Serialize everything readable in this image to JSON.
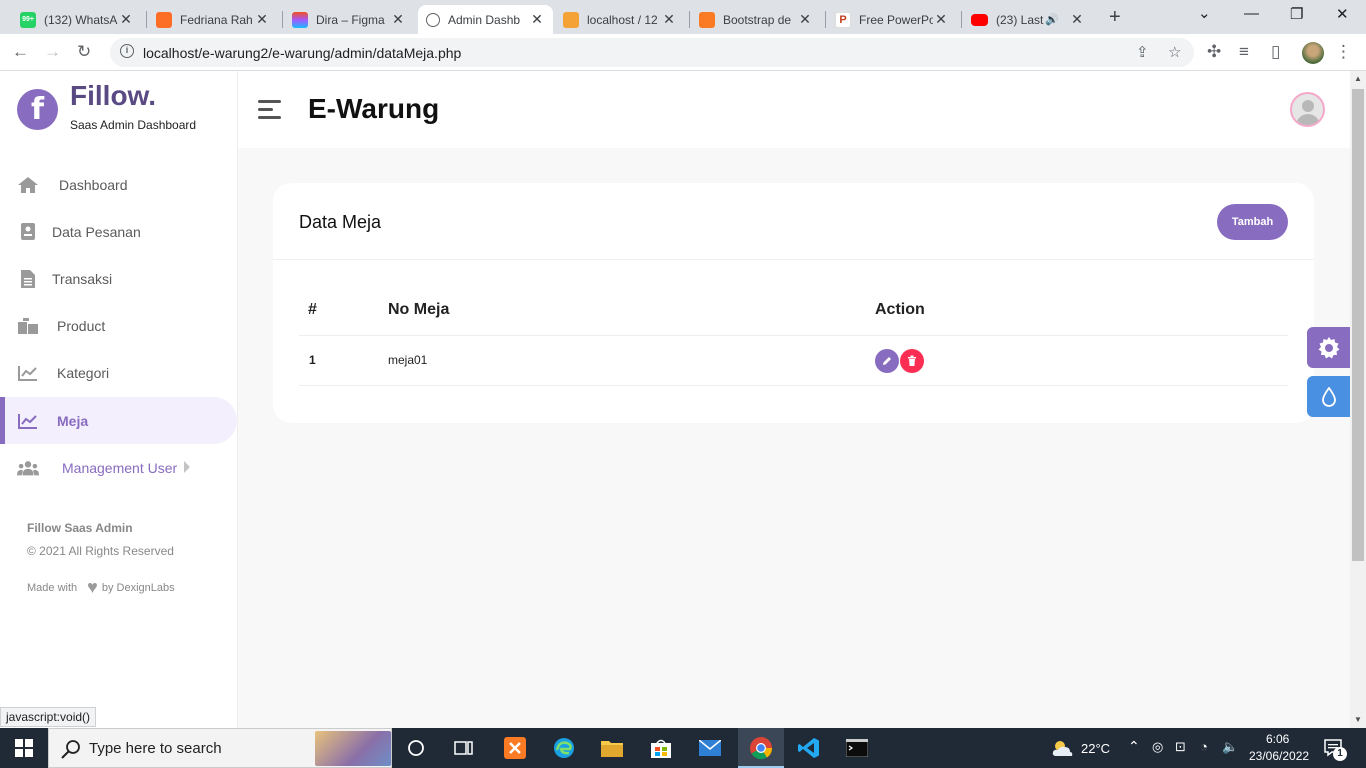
{
  "browser": {
    "tabs": [
      {
        "title": "(132) WhatsA",
        "badge": "99+"
      },
      {
        "title": "Fedriana Rah"
      },
      {
        "title": "Dira – Figma"
      },
      {
        "title": "Admin Dashb"
      },
      {
        "title": "localhost / 12"
      },
      {
        "title": "Bootstrap de"
      },
      {
        "title": "Free PowerPo"
      },
      {
        "title": "(23) Last"
      }
    ],
    "url": "localhost/e-warung2/e-warung/admin/dataMeja.php",
    "status_url": "javascript:void()"
  },
  "sidebar": {
    "brand_logo_letter": "f",
    "brand_name": "Fillow.",
    "brand_subtitle": "Saas Admin Dashboard",
    "items": [
      {
        "label": "Dashboard",
        "icon": "home-icon"
      },
      {
        "label": "Data Pesanan",
        "icon": "clipboard-icon"
      },
      {
        "label": "Transaksi",
        "icon": "document-icon"
      },
      {
        "label": "Product",
        "icon": "box-icon"
      },
      {
        "label": "Kategori",
        "icon": "chart-line-icon"
      },
      {
        "label": "Meja",
        "icon": "chart-line-icon",
        "active": true
      },
      {
        "label": "Management User",
        "icon": "users-icon"
      }
    ],
    "footer": {
      "name": "Fillow Saas Admin",
      "rights": "© 2021 All Rights Reserved",
      "made_with": "Made with",
      "by": "by DexignLabs"
    }
  },
  "header": {
    "title": "E-Warung"
  },
  "card": {
    "title": "Data Meja",
    "add_button": "Tambah",
    "columns": [
      "#",
      "No Meja",
      "Action"
    ],
    "rows": [
      {
        "num": "1",
        "no_meja": "meja01"
      }
    ]
  },
  "taskbar": {
    "search_placeholder": "Type here to search",
    "temperature": "22°C",
    "time": "6:06",
    "date": "23/06/2022",
    "notification_count": "1"
  },
  "colors": {
    "accent": "#886cc0",
    "delete": "#fc2e53",
    "info": "#4a90e2"
  }
}
